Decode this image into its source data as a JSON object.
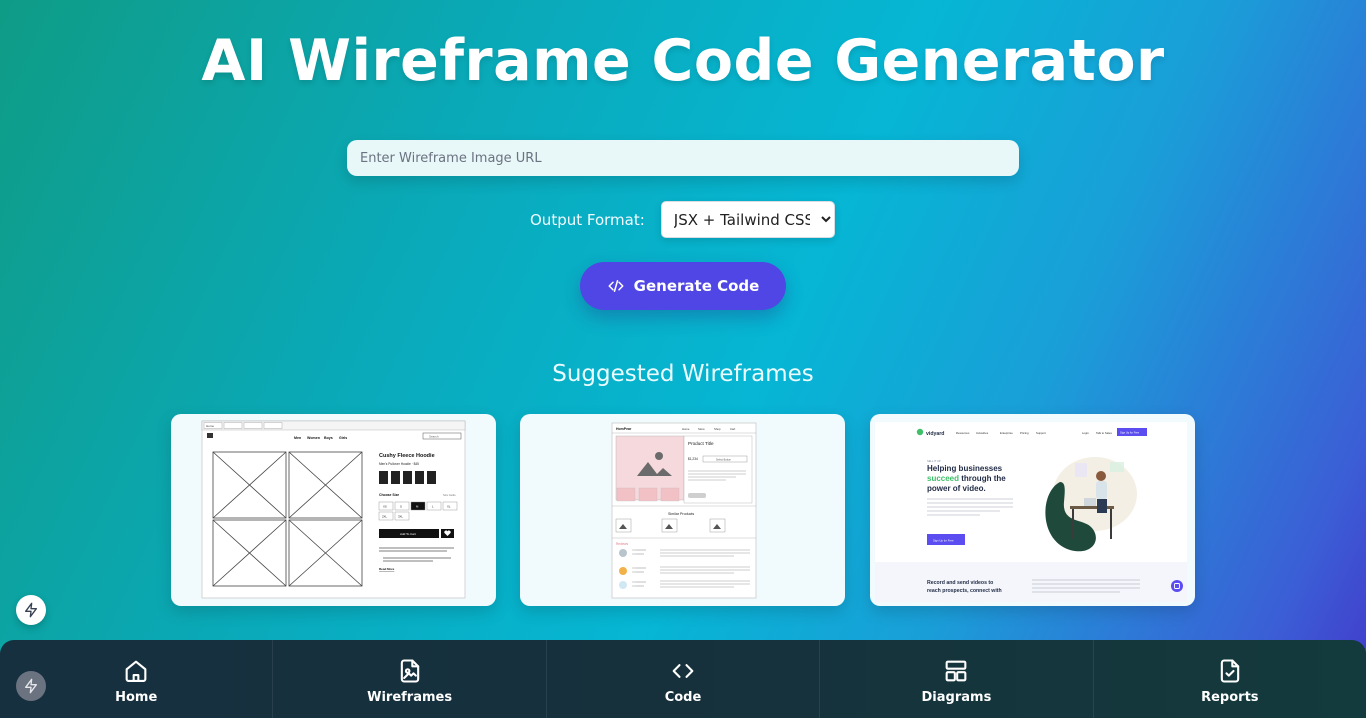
{
  "page": {
    "title": "AI Wireframe Code Generator"
  },
  "form": {
    "url_placeholder": "Enter Wireframe Image URL",
    "url_value": "",
    "format_label": "Output Format:",
    "format_selected": "JSX + Tailwind CSS",
    "format_options": [
      "JSX + Tailwind CSS"
    ],
    "generate_label": "Generate Code"
  },
  "suggestions": {
    "title": "Suggested Wireframes",
    "card1": {
      "tabs": [
        "Home",
        "Blog",
        "Contact"
      ],
      "nav": [
        "Men",
        "Women",
        "Boys",
        "Girls"
      ],
      "search": "Search",
      "product_title": "Cushy Fleece Hoodie",
      "product_subtitle": "Men's Pullover Hoodie · $45",
      "choose_size": "Choose Size",
      "size_guide": "Size Guide",
      "sizes": [
        "XS",
        "S",
        "M",
        "L",
        "XL",
        "2XL",
        "3XL"
      ],
      "add_to_cart": "Add To Cart",
      "read_more": "Read More"
    },
    "card2": {
      "logo": "HomPear",
      "nav": [
        "Home",
        "Store",
        "Shop",
        "Cart"
      ],
      "product_title": "Product Title",
      "price": "$1,234",
      "select_label": "Select Button",
      "similar": "Similar Products",
      "reviews": "Reviews"
    },
    "card3": {
      "brand": "vidyard",
      "nav": [
        "Resources",
        "Industries",
        "Enterprise",
        "Pricing",
        "Support"
      ],
      "login": "Login",
      "talk": "Talk to Sales",
      "signup": "Sign Up for Free",
      "eyebrow": "SELL IT UP",
      "headline_1": "Helping businesses",
      "headline_2a": "succeed",
      "headline_2b": " through the",
      "headline_3": "power of video.",
      "cta": "Sign Up for Free",
      "footer_1": "Record and send videos to",
      "footer_2": "reach prospects, connect with"
    }
  },
  "nav": {
    "items": [
      {
        "label": "Home",
        "icon": "home-icon"
      },
      {
        "label": "Wireframes",
        "icon": "wireframe-image-icon"
      },
      {
        "label": "Code",
        "icon": "code-icon"
      },
      {
        "label": "Diagrams",
        "icon": "layout-icon"
      },
      {
        "label": "Reports",
        "icon": "report-check-icon"
      }
    ]
  },
  "colors": {
    "accent": "#4f46e5",
    "nav_bg": "#16313c"
  }
}
